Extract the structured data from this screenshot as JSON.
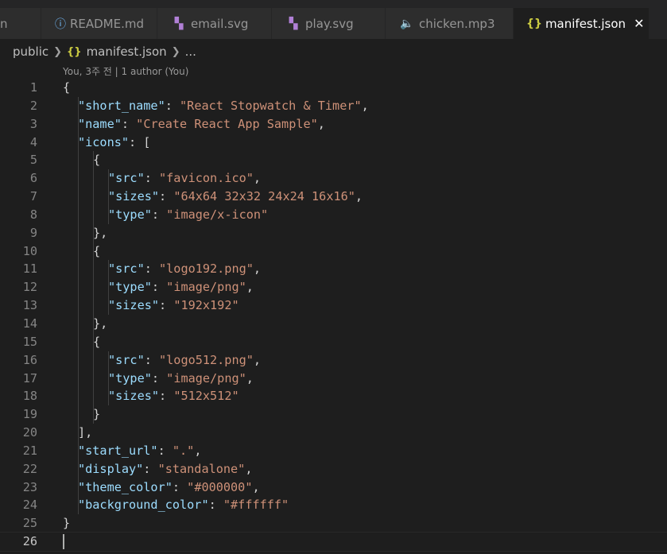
{
  "tabs": [
    {
      "label": "son",
      "icon": "",
      "active": false
    },
    {
      "label": "README.md",
      "icon": "info-icon",
      "active": false
    },
    {
      "label": "email.svg",
      "icon": "svg-file-icon",
      "active": false
    },
    {
      "label": "play.svg",
      "icon": "svg-file-icon",
      "active": false
    },
    {
      "label": "chicken.mp3",
      "icon": "audio-file-icon",
      "active": false
    },
    {
      "label": "manifest.json",
      "icon": "json-braces-icon",
      "active": true
    }
  ],
  "json_icon_glyph": "{}",
  "close_glyph": "✕",
  "breadcrumb": {
    "folder": "public",
    "file": "manifest.json",
    "more": "..."
  },
  "codelens": "You, 3주 전 | 1 author (You)",
  "lines": [
    {
      "n": "1",
      "indent": 0,
      "parts": [
        [
          "p",
          "{"
        ]
      ]
    },
    {
      "n": "2",
      "indent": 1,
      "parts": [
        [
          "k",
          "\"short_name\""
        ],
        [
          "p",
          ": "
        ],
        [
          "s",
          "\"React Stopwatch & Timer\""
        ],
        [
          "p",
          ","
        ]
      ]
    },
    {
      "n": "3",
      "indent": 1,
      "parts": [
        [
          "k",
          "\"name\""
        ],
        [
          "p",
          ": "
        ],
        [
          "s",
          "\"Create React App Sample\""
        ],
        [
          "p",
          ","
        ]
      ]
    },
    {
      "n": "4",
      "indent": 1,
      "parts": [
        [
          "k",
          "\"icons\""
        ],
        [
          "p",
          ": ["
        ]
      ]
    },
    {
      "n": "5",
      "indent": 2,
      "parts": [
        [
          "p",
          "{"
        ]
      ]
    },
    {
      "n": "6",
      "indent": 3,
      "parts": [
        [
          "k",
          "\"src\""
        ],
        [
          "p",
          ": "
        ],
        [
          "s",
          "\"favicon.ico\""
        ],
        [
          "p",
          ","
        ]
      ]
    },
    {
      "n": "7",
      "indent": 3,
      "parts": [
        [
          "k",
          "\"sizes\""
        ],
        [
          "p",
          ": "
        ],
        [
          "s",
          "\"64x64 32x32 24x24 16x16\""
        ],
        [
          "p",
          ","
        ]
      ]
    },
    {
      "n": "8",
      "indent": 3,
      "parts": [
        [
          "k",
          "\"type\""
        ],
        [
          "p",
          ": "
        ],
        [
          "s",
          "\"image/x-icon\""
        ]
      ]
    },
    {
      "n": "9",
      "indent": 2,
      "parts": [
        [
          "p",
          "},"
        ]
      ]
    },
    {
      "n": "10",
      "indent": 2,
      "parts": [
        [
          "p",
          "{"
        ]
      ]
    },
    {
      "n": "11",
      "indent": 3,
      "parts": [
        [
          "k",
          "\"src\""
        ],
        [
          "p",
          ": "
        ],
        [
          "s",
          "\"logo192.png\""
        ],
        [
          "p",
          ","
        ]
      ]
    },
    {
      "n": "12",
      "indent": 3,
      "parts": [
        [
          "k",
          "\"type\""
        ],
        [
          "p",
          ": "
        ],
        [
          "s",
          "\"image/png\""
        ],
        [
          "p",
          ","
        ]
      ]
    },
    {
      "n": "13",
      "indent": 3,
      "parts": [
        [
          "k",
          "\"sizes\""
        ],
        [
          "p",
          ": "
        ],
        [
          "s",
          "\"192x192\""
        ]
      ]
    },
    {
      "n": "14",
      "indent": 2,
      "parts": [
        [
          "p",
          "},"
        ]
      ]
    },
    {
      "n": "15",
      "indent": 2,
      "parts": [
        [
          "p",
          "{"
        ]
      ]
    },
    {
      "n": "16",
      "indent": 3,
      "parts": [
        [
          "k",
          "\"src\""
        ],
        [
          "p",
          ": "
        ],
        [
          "s",
          "\"logo512.png\""
        ],
        [
          "p",
          ","
        ]
      ]
    },
    {
      "n": "17",
      "indent": 3,
      "parts": [
        [
          "k",
          "\"type\""
        ],
        [
          "p",
          ": "
        ],
        [
          "s",
          "\"image/png\""
        ],
        [
          "p",
          ","
        ]
      ]
    },
    {
      "n": "18",
      "indent": 3,
      "parts": [
        [
          "k",
          "\"sizes\""
        ],
        [
          "p",
          ": "
        ],
        [
          "s",
          "\"512x512\""
        ]
      ]
    },
    {
      "n": "19",
      "indent": 2,
      "parts": [
        [
          "p",
          "}"
        ]
      ]
    },
    {
      "n": "20",
      "indent": 1,
      "parts": [
        [
          "p",
          "],"
        ]
      ]
    },
    {
      "n": "21",
      "indent": 1,
      "parts": [
        [
          "k",
          "\"start_url\""
        ],
        [
          "p",
          ": "
        ],
        [
          "s",
          "\".\""
        ],
        [
          "p",
          ","
        ]
      ]
    },
    {
      "n": "22",
      "indent": 1,
      "parts": [
        [
          "k",
          "\"display\""
        ],
        [
          "p",
          ": "
        ],
        [
          "s",
          "\"standalone\""
        ],
        [
          "p",
          ","
        ]
      ]
    },
    {
      "n": "23",
      "indent": 1,
      "parts": [
        [
          "k",
          "\"theme_color\""
        ],
        [
          "p",
          ": "
        ],
        [
          "s",
          "\"#000000\""
        ],
        [
          "p",
          ","
        ]
      ]
    },
    {
      "n": "24",
      "indent": 1,
      "parts": [
        [
          "k",
          "\"background_color\""
        ],
        [
          "p",
          ": "
        ],
        [
          "s",
          "\"#ffffff\""
        ]
      ]
    },
    {
      "n": "25",
      "indent": 0,
      "parts": [
        [
          "p",
          "}"
        ]
      ]
    },
    {
      "n": "26",
      "indent": 0,
      "parts": [],
      "current": true
    }
  ]
}
